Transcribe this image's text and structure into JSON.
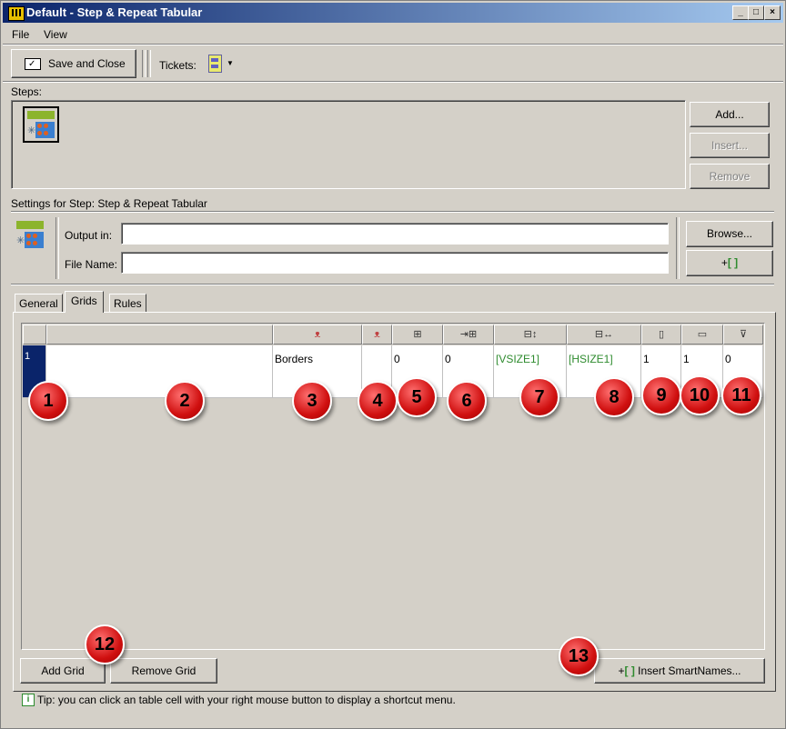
{
  "window": {
    "title": "Default - Step & Repeat Tabular",
    "min": "_",
    "max": "□",
    "close": "×"
  },
  "menu": [
    {
      "label": "File"
    },
    {
      "label": "View"
    }
  ],
  "toolbar": {
    "save_close": "Save and Close",
    "tickets": "Tickets:"
  },
  "steps": {
    "label": "Steps:",
    "add": "Add...",
    "insert": "Insert...",
    "remove": "Remove"
  },
  "settings": {
    "heading": "Settings for Step: Step & Repeat Tabular",
    "output_label": "Output in:",
    "output_value": "",
    "filename_label": "File Name:",
    "filename_value": "",
    "browse": "Browse...",
    "smart_plus": "+",
    "smart_brackets": "[ ]"
  },
  "tabs": [
    {
      "label": "General"
    },
    {
      "label": "Grids"
    },
    {
      "label": "Rules"
    }
  ],
  "active_tab": "Grids",
  "grid": {
    "rows": [
      {
        "num": "1",
        "name": "",
        "marks": "Borders",
        "marks2": "",
        "c5": "0",
        "c6": "0",
        "c7": "[VSIZE1]",
        "c8": "[HSIZE1]",
        "c9": "1",
        "c10": "1",
        "c11": "0"
      }
    ]
  },
  "callouts": [
    "1",
    "2",
    "3",
    "4",
    "5",
    "6",
    "7",
    "8",
    "9",
    "10",
    "11",
    "12",
    "13"
  ],
  "buttons": {
    "add_grid": "Add Grid",
    "remove_grid": "Remove Grid",
    "insert_plus": "+",
    "insert_brackets": "[ ]",
    "insert_smart": "Insert SmartNames..."
  },
  "tip": "Tip: you can click an table cell with your right mouse button to display a shortcut menu.",
  "colors": {
    "title_start": "#0a246a",
    "title_end": "#a6caf0",
    "smartname_green": "#2e8b2e",
    "callout_red": "#d01010",
    "selected_row": "#0a246a"
  }
}
